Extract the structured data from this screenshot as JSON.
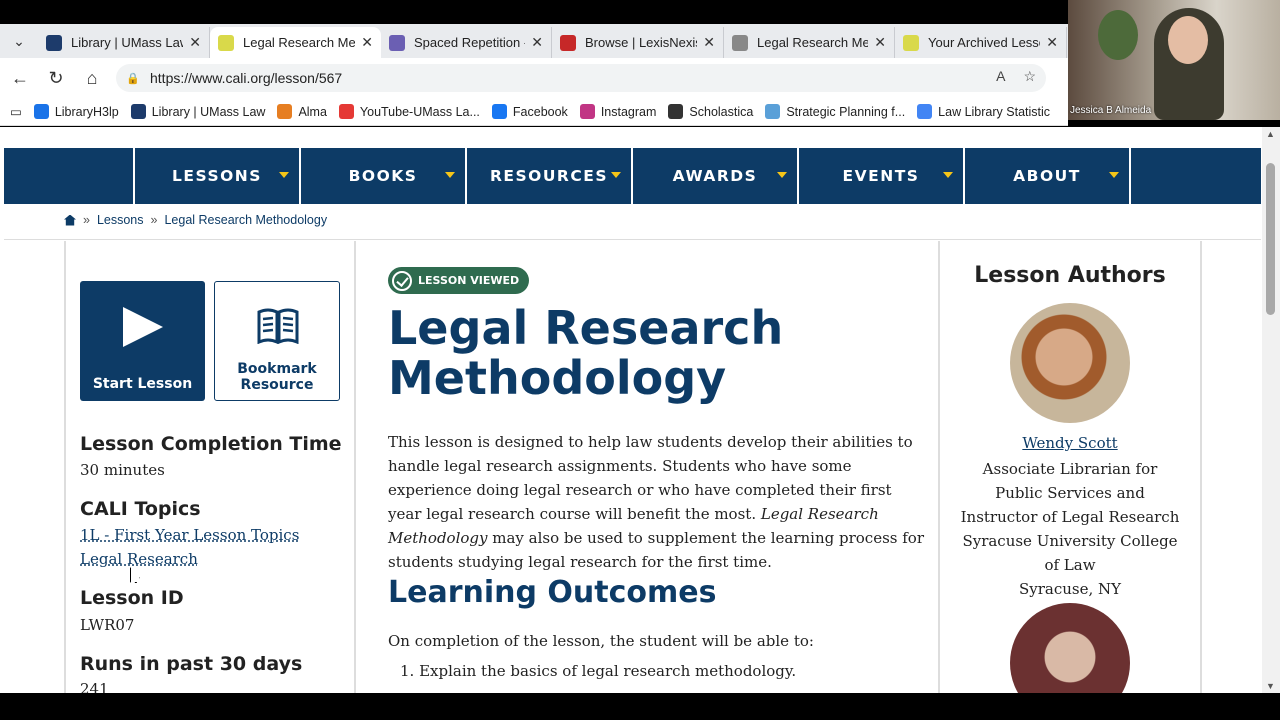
{
  "browser": {
    "tabs": [
      {
        "title": "Library | UMass Law",
        "favicon_color": "#1d3b6b"
      },
      {
        "title": "Legal Research Meth",
        "favicon_color": "#d9d94a",
        "active": true
      },
      {
        "title": "Spaced Repetition -",
        "favicon_color": "#6b5fb3"
      },
      {
        "title": "Browse | LexisNexis",
        "favicon_color": "#c62828"
      },
      {
        "title": "Legal Research Meth",
        "favicon_color": "#888888"
      },
      {
        "title": "Your Archived Lesso",
        "favicon_color": "#d9d94a"
      }
    ],
    "url": "https://www.cali.org/lesson/567",
    "bookmarks": [
      {
        "label": "LibraryH3lp",
        "color": "#1a73e8"
      },
      {
        "label": "Library | UMass Law",
        "color": "#1d3b6b"
      },
      {
        "label": "Alma",
        "color": "#e67e22"
      },
      {
        "label": "YouTube-UMass La...",
        "color": "#e53935"
      },
      {
        "label": "Facebook",
        "color": "#1877f2"
      },
      {
        "label": "Instagram",
        "color": "#c13584"
      },
      {
        "label": "Scholastica",
        "color": "#333333"
      },
      {
        "label": "Strategic Planning f...",
        "color": "#5aa0d8"
      },
      {
        "label": "Law Library Statistic",
        "color": "#4285f4"
      }
    ]
  },
  "video": {
    "name": "Jessica B Almeida"
  },
  "site": {
    "nav": [
      "LESSONS",
      "BOOKS",
      "RESOURCES",
      "AWARDS",
      "EVENTS",
      "ABOUT"
    ],
    "breadcrumb": {
      "lessons": "Lessons",
      "current": "Legal Research Methodology"
    }
  },
  "lesson": {
    "start_label": "Start Lesson",
    "bookmark_label_1": "Bookmark",
    "bookmark_label_2": "Resource",
    "badge": "LESSON VIEWED",
    "title_line1": "Legal Research",
    "title_line2": "Methodology",
    "desc_part1": "This lesson is designed to help law students develop their abilities to handle legal research assignments. Students who have some experience doing legal research or who have completed their first year legal research course will benefit the most. ",
    "desc_italic": "Legal Research Methodology",
    "desc_part2": " may also be used to supplement the learning process for students studying legal research for the first time.",
    "outcomes_heading": "Learning Outcomes",
    "outcomes_intro": "On completion of the lesson, the student will be able to:",
    "outcome_1": "1. Explain the basics of legal research methodology.",
    "completion_heading": "Lesson Completion Time",
    "completion_value": "30 minutes",
    "topics_heading": "CALI Topics",
    "topic_1": "1L - First Year Lesson Topics",
    "topic_2": "Legal Research",
    "id_heading": "Lesson ID",
    "id_value": "LWR07",
    "runs_heading": "Runs in past 30 days",
    "runs_value": "241"
  },
  "authors": {
    "heading": "Lesson Authors",
    "name": "Wendy Scott",
    "info_1": "Associate Librarian for",
    "info_2": "Public Services and",
    "info_3": "Instructor of Legal Research",
    "info_4": "Syracuse University College",
    "info_5": "of Law",
    "info_6": "Syracuse, NY"
  }
}
